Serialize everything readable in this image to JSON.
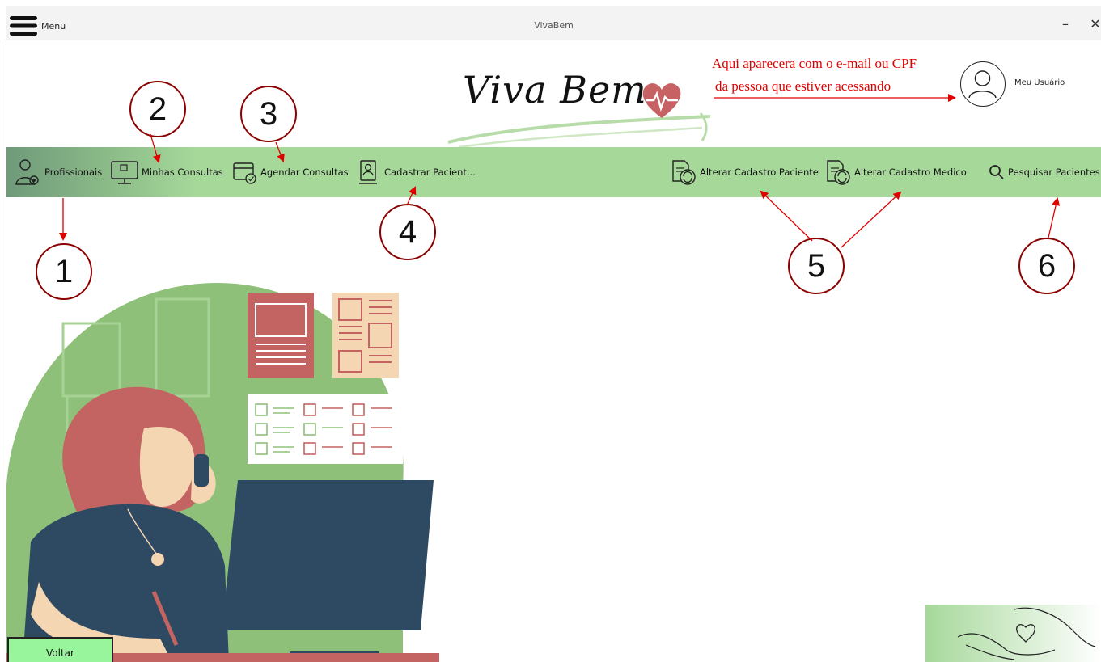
{
  "window": {
    "menu_label": "Menu",
    "title": "VivaBem",
    "minimize_glyph": "–",
    "close_glyph": "✕"
  },
  "logo": {
    "text": "Viva Bem"
  },
  "annotation": {
    "line1": "Aqui aparecera com o e-mail ou CPF",
    "line2": "da pessoa que estiver acessando",
    "color": "#e00000"
  },
  "user": {
    "label": "Meu Usuário",
    "icon": "user-icon"
  },
  "nav": {
    "items": [
      {
        "label": "Profissionais",
        "icon": "doctor-icon"
      },
      {
        "label": "Minhas Consultas",
        "icon": "computer-icon"
      },
      {
        "label": "Agendar Consultas",
        "icon": "calendar-icon"
      },
      {
        "label": "Cadastrar Pacient...",
        "icon": "register-icon"
      },
      {
        "label": "Alterar Cadastro Paciente",
        "icon": "document-refresh-icon"
      },
      {
        "label": "Alterar Cadastro Medico",
        "icon": "document-refresh-icon"
      },
      {
        "label": "Pesquisar Pacientes",
        "icon": "search-icon"
      }
    ],
    "background": "#a6d89a"
  },
  "markers": [
    "1",
    "2",
    "3",
    "4",
    "5",
    "6"
  ],
  "footer": {
    "back_label": "Voltar",
    "back_color": "#99f59c"
  }
}
